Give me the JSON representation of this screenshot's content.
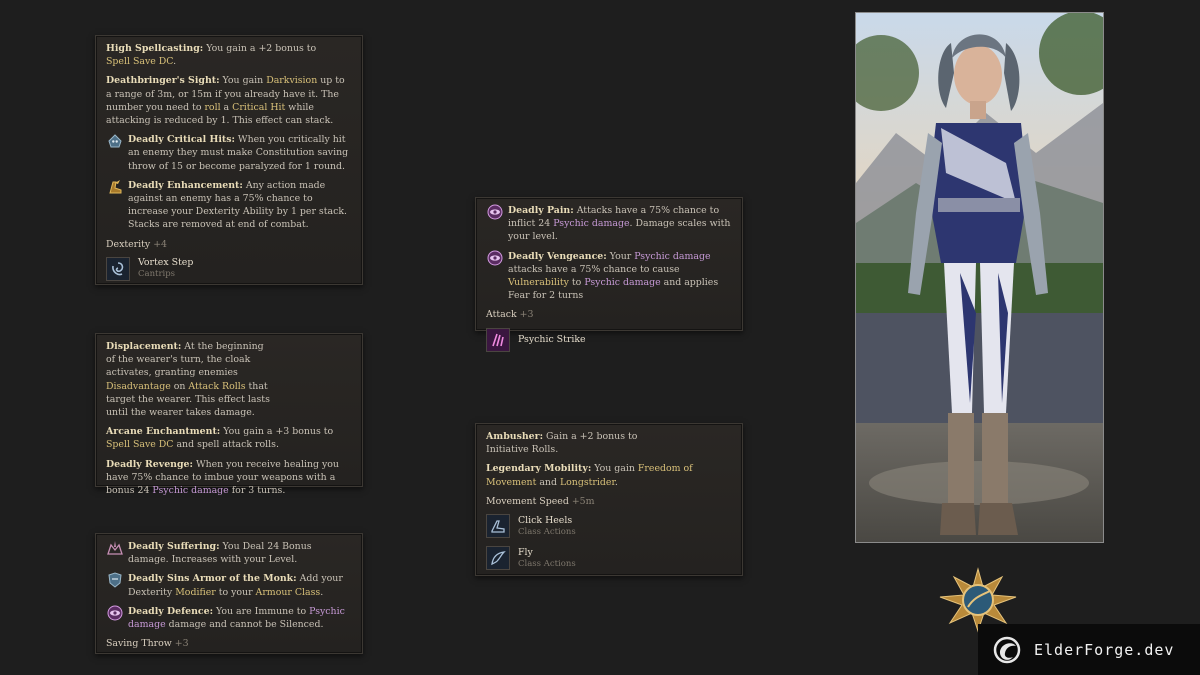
{
  "panel_helmet": {
    "p1": {
      "name": "High Spellcasting:",
      "t1": " You gain a +2 bonus to ",
      "h1": "Spell Save DC",
      "t2": "."
    },
    "p2": {
      "name": "Deathbringer's Sight:",
      "t1": " You gain ",
      "h1": "Darkvision",
      "t2": " up to a range of 3m, or 15m if you already have it. The number you need to ",
      "h2": "roll",
      "t3": " a ",
      "h3": "Critical Hit",
      "t4": " while attacking is reduced by 1. This effect can stack."
    },
    "p3": {
      "name": "Deadly Critical Hits:",
      "t1": " When you critically hit an enemy they must make Constitution saving throw of 15 or become paralyzed for 1 round."
    },
    "p4": {
      "name": "Deadly Enhancement:",
      "t1": " Any action made against an enemy has a 75% chance to increase your Dexterity Ability by 1 per stack. Stacks are removed at end of combat."
    },
    "stat": {
      "label": "Dexterity",
      "value": "+4"
    },
    "ability": {
      "name": "Vortex Step",
      "sub": "Cantrips"
    }
  },
  "panel_cloak": {
    "p1": {
      "name": "Displacement:",
      "t1": " At the beginning of the wearer's turn, the cloak activates, granting enemies ",
      "h1": "Disadvantage",
      "t2": " on ",
      "h2": "Attack Rolls",
      "t3": " that target the wearer. This effect lasts until the wearer takes damage."
    },
    "p2": {
      "name": "Arcane Enchantment:",
      "t1": " You gain a +3 bonus to ",
      "h1": "Spell Save DC",
      "t2": " and spell attack rolls."
    },
    "p3": {
      "name": "Deadly Revenge:",
      "t1": " When you receive healing you have 75% chance to imbue your weapons with a bonus 24 ",
      "h1": "Psychic damage",
      "t2": " for 3 turns."
    }
  },
  "panel_armor": {
    "p1": {
      "name": "Deadly Suffering:",
      "t1": " You Deal 24 Bonus damage. Increases with your Level."
    },
    "p2": {
      "name": "Deadly Sins Armor of the Monk:",
      "t1": " Add your Dexterity ",
      "h1": "Modifier",
      "t2": " to your ",
      "h2": "Armour Class",
      "t3": "."
    },
    "p3": {
      "name": "Deadly Defence:",
      "t1": " You are Immune to ",
      "h1": "Psychic damage",
      "t2": " damage and cannot be Silenced."
    },
    "stat": {
      "label": "Saving Throw",
      "value": "+3"
    }
  },
  "panel_gloves": {
    "p1": {
      "name": "Deadly Pain:",
      "t1": " Attacks have a 75% chance to inflict 24 ",
      "h1": "Psychic damage",
      "t2": ". Damage scales with your level."
    },
    "p2": {
      "name": "Deadly Vengeance:",
      "t1": " Your ",
      "h1": "Psychic damage",
      "t2": " attacks have a 75% chance to cause ",
      "h2": "Vulnerability",
      "t3": " to ",
      "h3": "Psychic damage",
      "t4": " and applies Fear for 2 turns"
    },
    "stat": {
      "label": "Attack",
      "value": "+3"
    },
    "ability": {
      "name": "Psychic Strike"
    }
  },
  "panel_boots": {
    "p1": {
      "name": "Ambusher:",
      "t1": " Gain a +2 bonus to Initiative Rolls."
    },
    "p2": {
      "name": "Legendary Mobility:",
      "t1": " You gain ",
      "h1": "Freedom of Movement",
      "t2": " and ",
      "h2": "Longstrider",
      "t3": "."
    },
    "stat": {
      "label": "Movement Speed",
      "value": "+5m"
    },
    "abilities": [
      {
        "name": "Click Heels",
        "sub": "Class Actions"
      },
      {
        "name": "Fly",
        "sub": "Class Actions"
      }
    ]
  },
  "brand": {
    "name": "ElderForge.dev"
  }
}
